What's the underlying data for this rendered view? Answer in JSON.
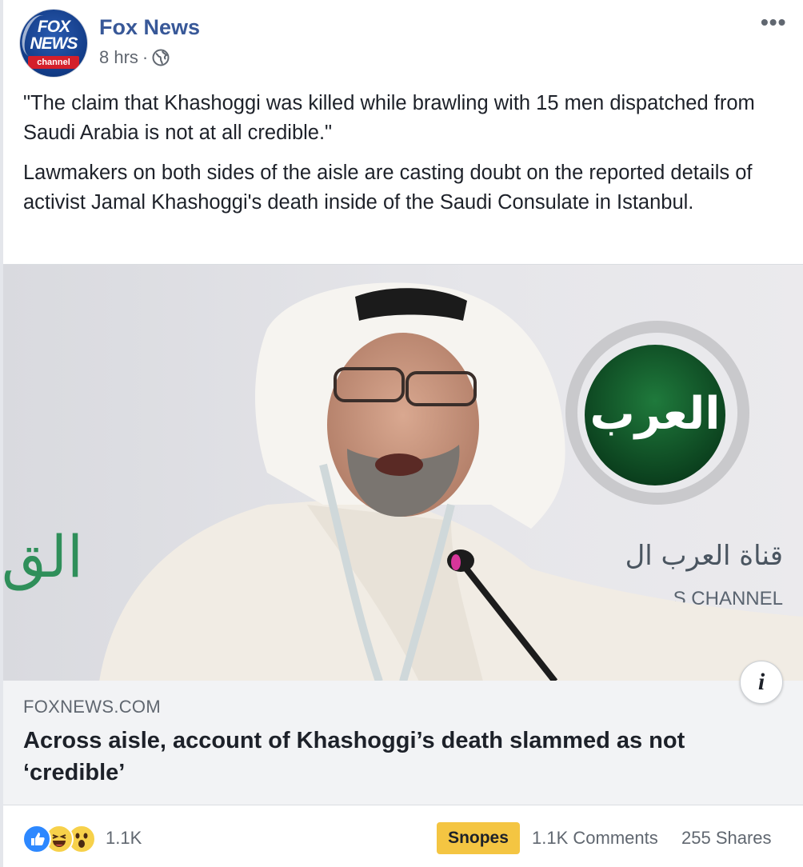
{
  "post": {
    "page_name": "Fox News",
    "timestamp": "8 hrs",
    "separator": "·",
    "privacy_icon": "globe-icon",
    "more_icon": "more-options-icon",
    "more_label": "•••",
    "avatar": {
      "line1": "FOX",
      "line2": "NEWS",
      "line3": "channel"
    },
    "quote": "\"The claim that Khashoggi was killed while brawling with 15 men dispatched from Saudi Arabia is not at all credible.\"",
    "body": "Lawmakers on both sides of the aisle are casting doubt on the reported details of activist Jamal Khashoggi's death inside of the Saudi Consulate in Istanbul."
  },
  "photo": {
    "logo_text": "العرب",
    "arabic_left": "الق",
    "channel_arabic": "قناة العرب ال",
    "channel_english": "S CHANNEL"
  },
  "link": {
    "domain": "FOXNEWS.COM",
    "headline": "Across aisle, account of Khashoggi’s death slammed as not ‘credible’",
    "info_label": "i"
  },
  "footer": {
    "reaction_icons": [
      "like-icon",
      "haha-icon",
      "wow-icon"
    ],
    "reaction_count": "1.1K",
    "snopes_label": "Snopes",
    "comments": "1.1K Comments",
    "shares": "255 Shares"
  },
  "colors": {
    "page_name": "#385898",
    "meta": "#606770",
    "link_bg": "#f2f3f5",
    "snopes": "#f4c542",
    "like": "#2d88ff"
  }
}
